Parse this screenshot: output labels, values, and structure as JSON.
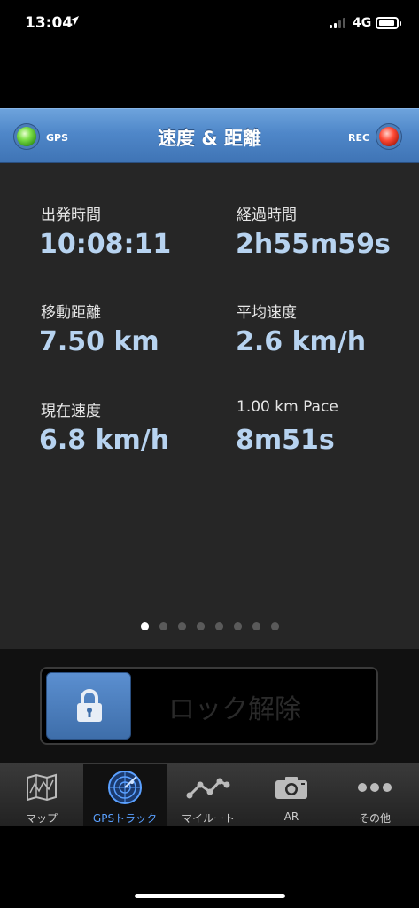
{
  "status_bar": {
    "time": "13:04",
    "network": "4G"
  },
  "navbar": {
    "title": "速度 & 距離",
    "gps_label": "GPS",
    "rec_label": "REC"
  },
  "stats": [
    {
      "label": "出発時間",
      "value": "10:08:11"
    },
    {
      "label": "経過時間",
      "value": "2h55m59s"
    },
    {
      "label": "移動距離",
      "value": "7.50 km"
    },
    {
      "label": "平均速度",
      "value": "2.6 km/h"
    },
    {
      "label": "現在速度",
      "value": "6.8 km/h"
    },
    {
      "label": "1.00 km Pace",
      "value": "8m51s"
    }
  ],
  "pager": {
    "pages": 8,
    "active_index": 0
  },
  "lock": {
    "label": "ロック解除"
  },
  "tabs": [
    {
      "label": "マップ",
      "icon": "map-icon"
    },
    {
      "label": "GPSトラック",
      "icon": "radar-icon",
      "active": true
    },
    {
      "label": "マイルート",
      "icon": "route-icon"
    },
    {
      "label": "AR",
      "icon": "camera-icon"
    },
    {
      "label": "その他",
      "icon": "more-icon"
    }
  ],
  "colors": {
    "accent": "#5aa0ff",
    "value_text": "#b7d3f0",
    "nav_blue": "#4f87c9"
  }
}
